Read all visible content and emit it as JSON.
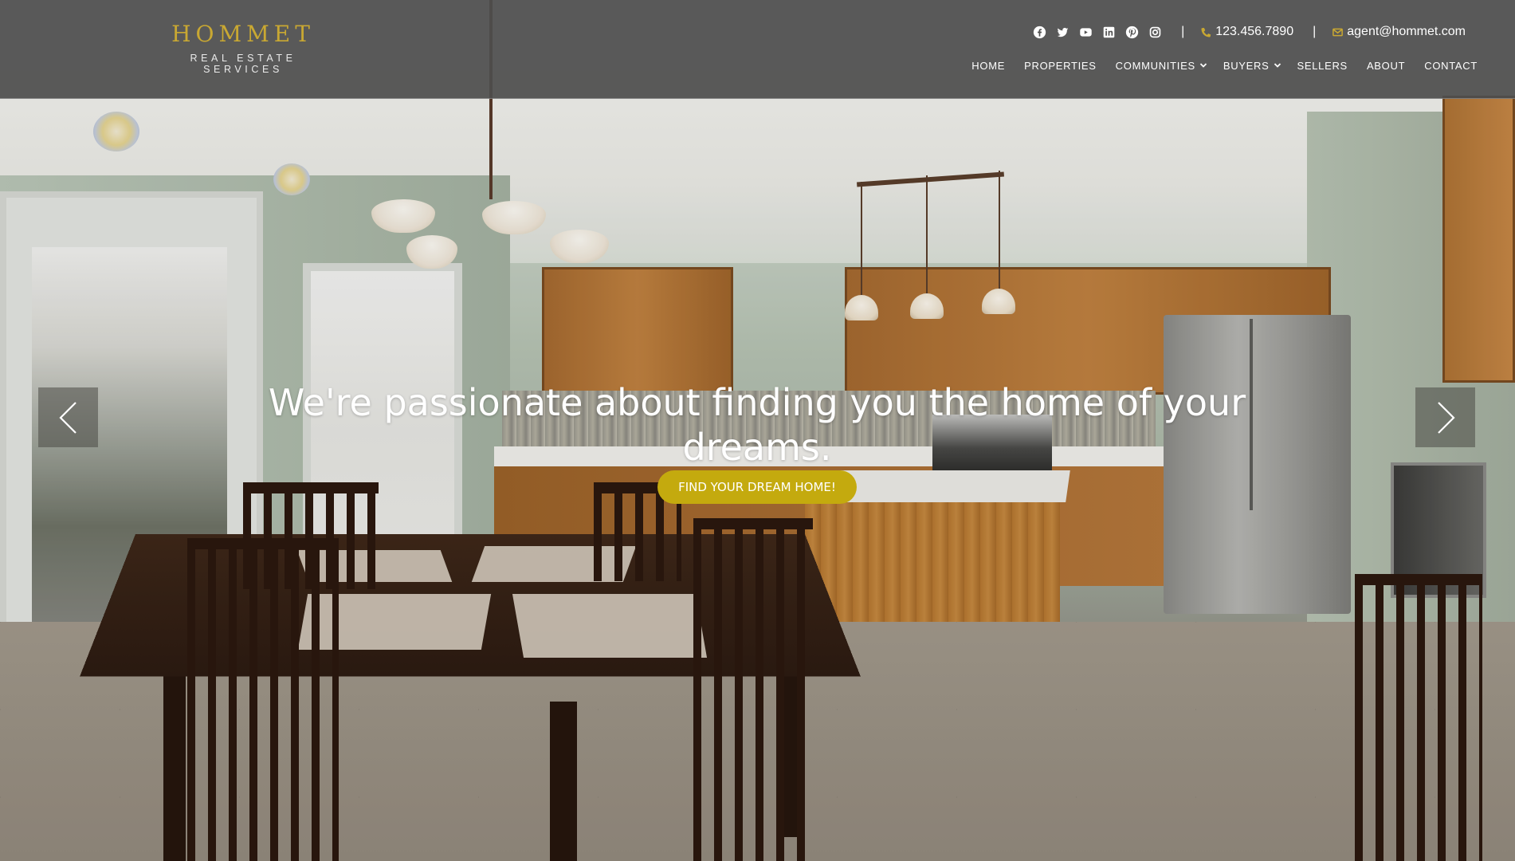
{
  "brand": {
    "name": "HOMMET",
    "tagline": "REAL ESTATE SERVICES",
    "accent_color": "#c9a832"
  },
  "topbar": {
    "social_icons": [
      "facebook-icon",
      "twitter-icon",
      "youtube-icon",
      "linkedin-icon",
      "pinterest-icon",
      "instagram-icon"
    ],
    "separator": "|",
    "phone": "123.456.7890",
    "email": "agent@hommet.com"
  },
  "nav": {
    "items": [
      {
        "label": "HOME",
        "has_dropdown": false
      },
      {
        "label": "PROPERTIES",
        "has_dropdown": false
      },
      {
        "label": "COMMUNITIES",
        "has_dropdown": true
      },
      {
        "label": "BUYERS",
        "has_dropdown": true
      },
      {
        "label": "SELLERS",
        "has_dropdown": false
      },
      {
        "label": "ABOUT",
        "has_dropdown": false
      },
      {
        "label": "CONTACT",
        "has_dropdown": false
      }
    ]
  },
  "hero": {
    "headline": "We're passionate about finding you the home of your dreams.",
    "cta_label": "FIND YOUR DREAM HOME!",
    "cta_color": "#c4aa0e",
    "prev_icon": "chevron-left-icon",
    "next_icon": "chevron-right-icon"
  }
}
